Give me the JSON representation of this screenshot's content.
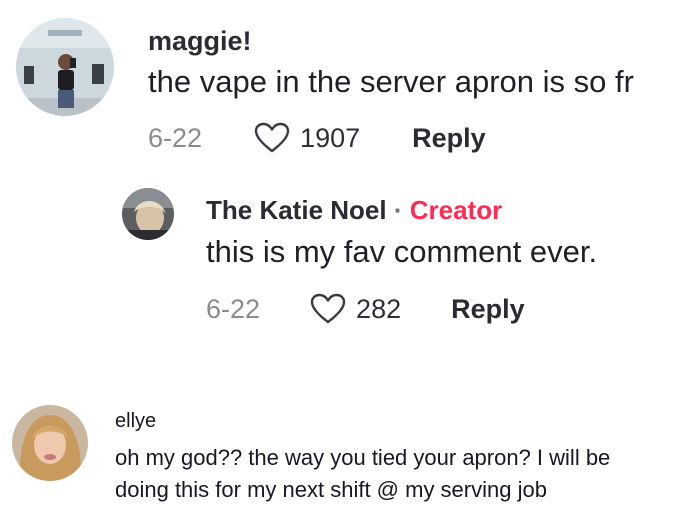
{
  "comments": [
    {
      "username": "maggie!",
      "text": "the vape in the server apron is so fr",
      "date": "6-22",
      "likes": "1907",
      "reply_label": "Reply",
      "icon": "heart-outline-icon"
    },
    {
      "username": "The Katie Noel",
      "separator": "·",
      "creator_tag": "Creator",
      "text": "this is my fav comment ever.",
      "date": "6-22",
      "likes": "282",
      "reply_label": "Reply",
      "icon": "heart-outline-icon",
      "accent_color": "#fe2c55"
    },
    {
      "username": "ellye",
      "text_line1": "oh my god?? the way you tied your apron? I will be",
      "text_line2": "doing this for my next shift @ my serving job"
    }
  ]
}
